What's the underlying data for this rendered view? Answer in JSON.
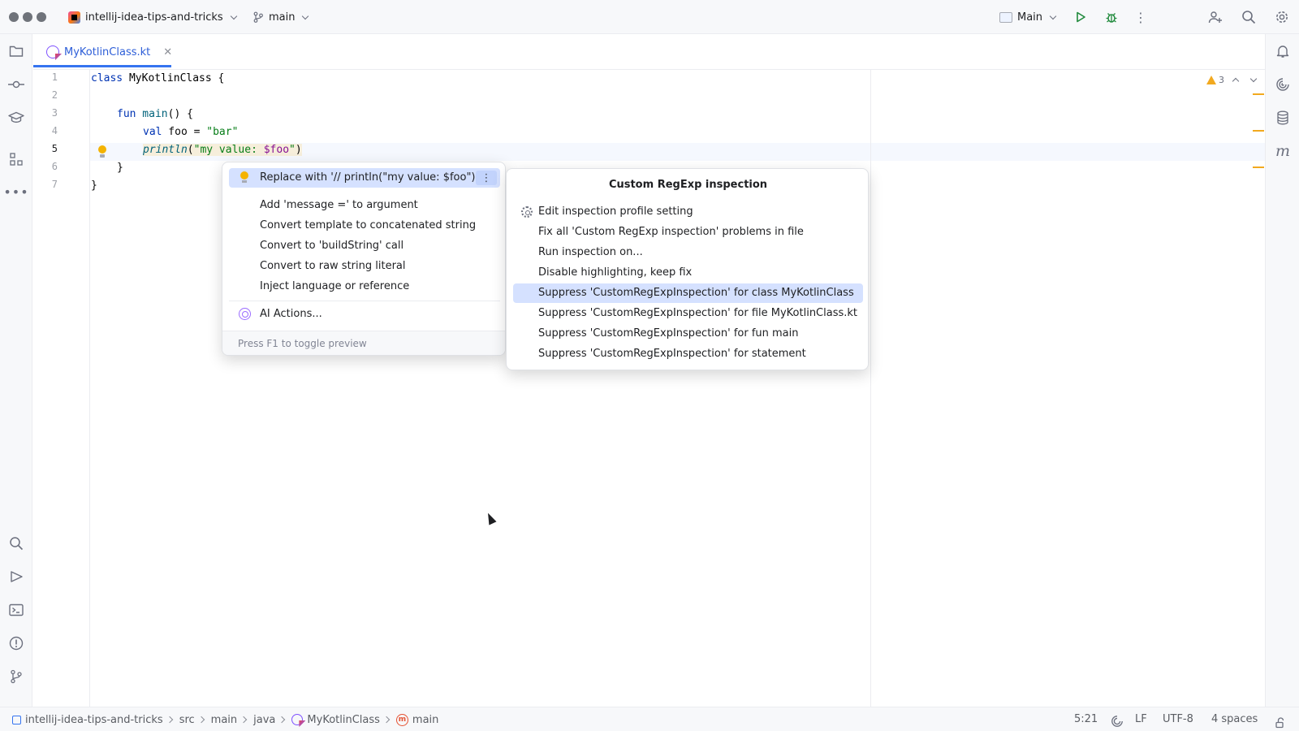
{
  "titlebar": {
    "project_name": "intellij-idea-tips-and-tricks",
    "branch": "main",
    "run_config": "Main"
  },
  "editor": {
    "tab_label": "MyKotlinClass.kt",
    "line_numbers": [
      "1",
      "2",
      "3",
      "4",
      "5",
      "6",
      "7"
    ],
    "code": {
      "l1_kw": "class",
      "l1_name": " MyKotlinClass ",
      "l1_brace": "{",
      "l3_kw": "fun",
      "l3_fn": " main",
      "l3_rest": "() {",
      "l4_kw": "val",
      "l4_mid": " foo = ",
      "l4_str": "\"bar\"",
      "l5_fn": "println",
      "l5_open": "(",
      "l5_str": "\"my value: ",
      "l5_var": "$foo",
      "l5_strend": "\"",
      "l5_close": ")",
      "l6": "}",
      "l7": "}"
    },
    "warning_count": "3",
    "colors": {
      "warning": "#f2a91f",
      "accent": "#3574f0"
    }
  },
  "intentions": {
    "primary": "Replace with '// println(\"my value: $foo\")'",
    "items": [
      "Add 'message =' to argument",
      "Convert template to concatenated string",
      "Convert to 'buildString' call",
      "Convert to raw string literal",
      "Inject language or reference"
    ],
    "ai_actions": "AI Actions...",
    "footer": "Press F1 to toggle preview"
  },
  "inspection": {
    "title": "Custom RegExp inspection",
    "items": [
      "Edit inspection profile setting",
      "Fix all 'Custom RegExp inspection' problems in file",
      "Run inspection on...",
      "Disable highlighting, keep fix",
      "Suppress 'CustomRegExpInspection' for class MyKotlinClass",
      "Suppress 'CustomRegExpInspection' for file MyKotlinClass.kt",
      "Suppress 'CustomRegExpInspection' for fun main",
      "Suppress 'CustomRegExpInspection' for statement"
    ]
  },
  "statusbar": {
    "breadcrumbs": [
      "intellij-idea-tips-and-tricks",
      "src",
      "main",
      "java",
      "MyKotlinClass",
      "main"
    ],
    "position": "5:21",
    "line_ending": "LF",
    "encoding": "UTF-8",
    "indent": "4 spaces"
  }
}
